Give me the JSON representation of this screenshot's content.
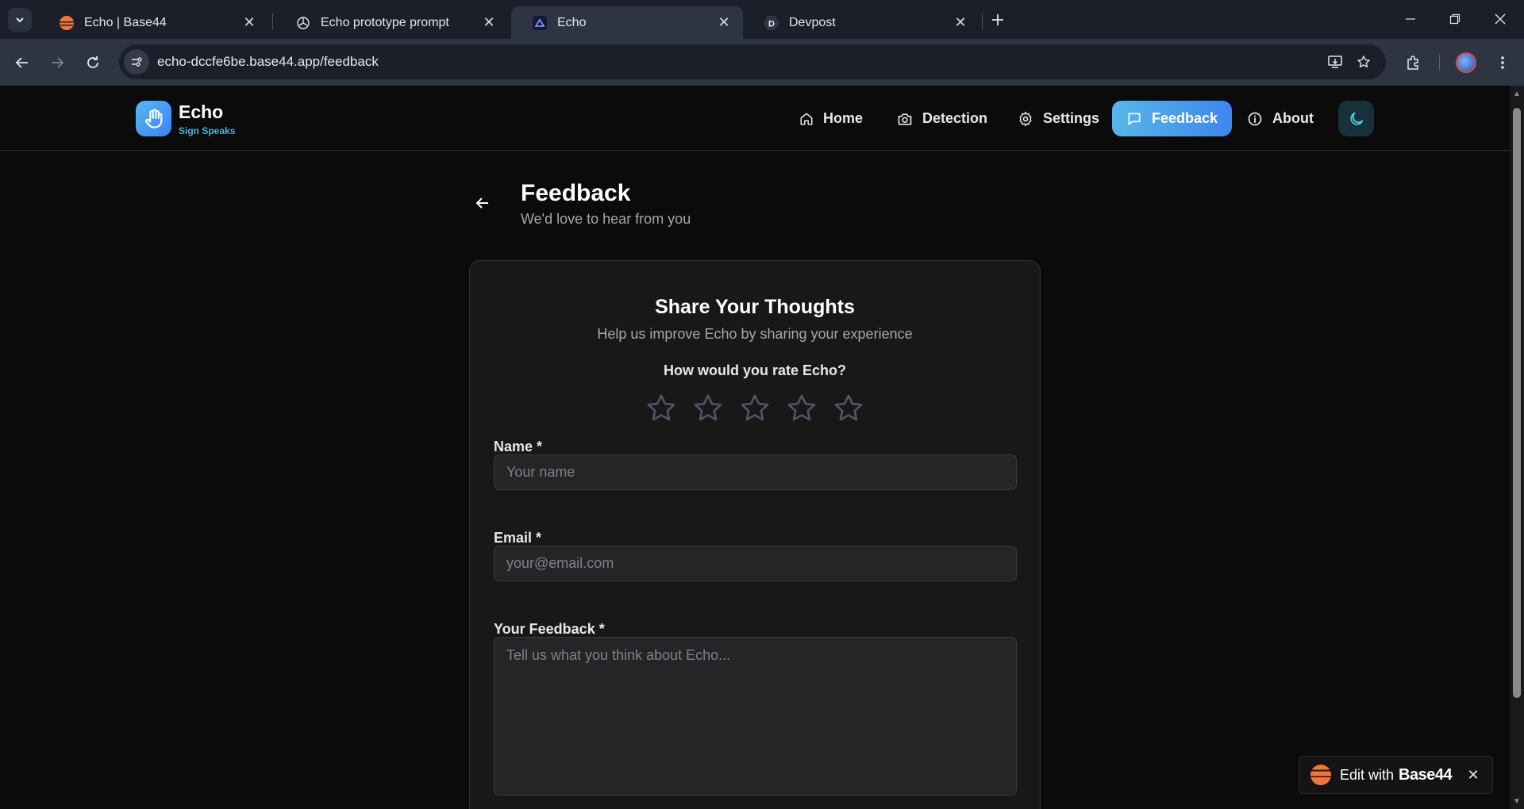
{
  "browser": {
    "tabs": [
      {
        "title": "Echo | Base44",
        "favicon": "base44-favicon-icon"
      },
      {
        "title": "Echo prototype prompt",
        "favicon": "openai-favicon-icon"
      },
      {
        "title": "Echo",
        "favicon": "echo-favicon-icon",
        "active": true
      },
      {
        "title": "Devpost",
        "favicon": "devpost-favicon-icon",
        "favicon_letter": "D"
      }
    ],
    "url": "echo-dccfe6be.base44.app/feedback"
  },
  "app": {
    "brand_name": "Echo",
    "brand_tagline": "Sign Speaks",
    "nav": [
      {
        "label": "Home",
        "icon": "home-icon"
      },
      {
        "label": "Detection",
        "icon": "camera-icon"
      },
      {
        "label": "Settings",
        "icon": "gear-icon"
      },
      {
        "label": "Feedback",
        "icon": "message-icon",
        "active": true
      },
      {
        "label": "About",
        "icon": "info-icon"
      }
    ],
    "accent": "#3d87ee",
    "accent_secondary": "#58b6e8"
  },
  "page": {
    "title": "Feedback",
    "subtitle": "We'd love to hear from you"
  },
  "card": {
    "title": "Share Your Thoughts",
    "subtitle": "Help us improve Echo by sharing your experience",
    "rating_label": "How would you rate Echo?",
    "rating": 0,
    "rating_max": 5,
    "name_label": "Name *",
    "name_placeholder": "Your name",
    "name_value": "",
    "email_label": "Email *",
    "email_placeholder": "your@email.com",
    "email_value": "",
    "feedback_label": "Your Feedback *",
    "feedback_placeholder": "Tell us what you think about Echo...",
    "feedback_value": ""
  },
  "badge": {
    "text": "Edit with",
    "brand": "Base44"
  }
}
